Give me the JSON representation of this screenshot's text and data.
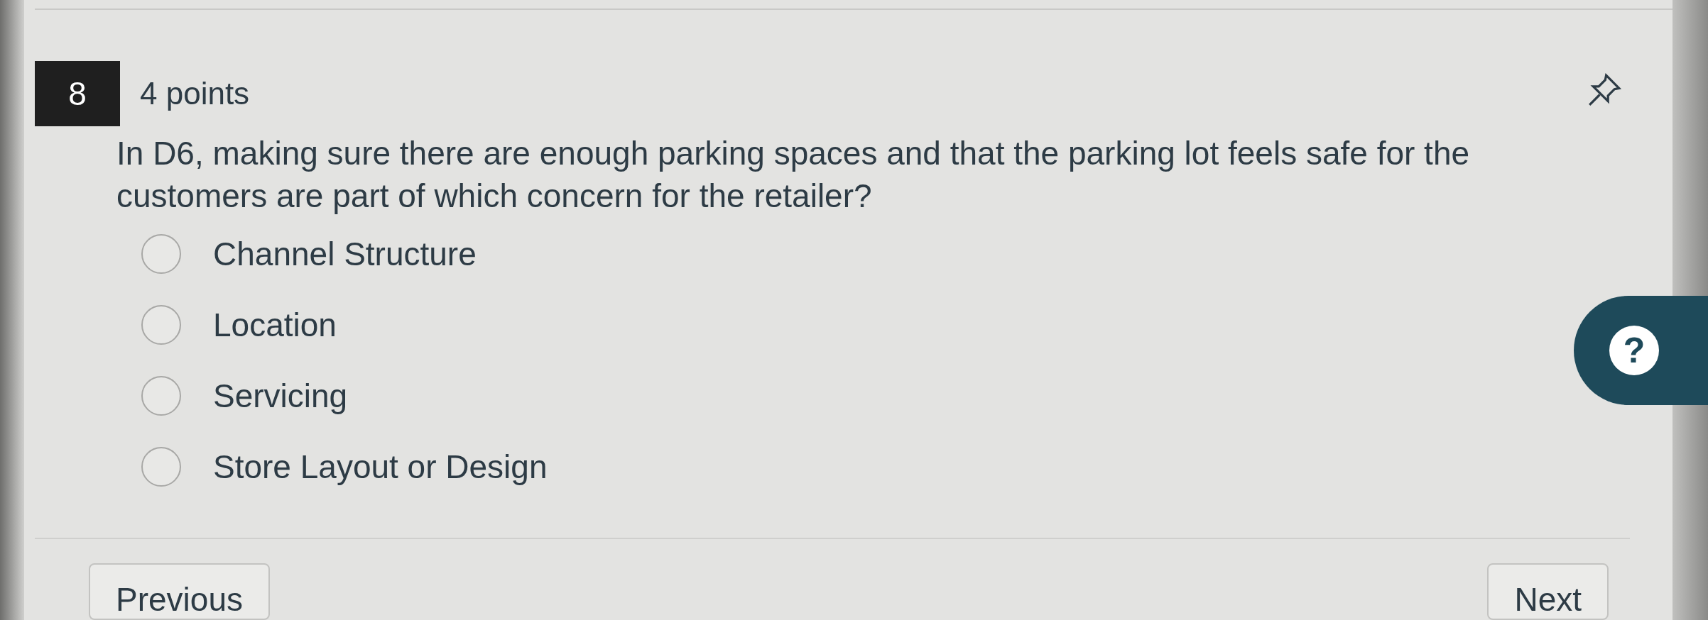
{
  "question": {
    "number": "8",
    "points": "4 points",
    "text": "In D6, making sure there are enough parking spaces and that the parking lot feels safe for the customers are part of which concern for the retailer?"
  },
  "options": [
    {
      "label": "Channel Structure",
      "selected": false
    },
    {
      "label": "Location",
      "selected": false
    },
    {
      "label": "Servicing",
      "selected": false
    },
    {
      "label": "Store Layout or Design",
      "selected": false
    }
  ],
  "help": {
    "label": "?"
  },
  "nav": {
    "previous": "Previous",
    "next": "Next"
  }
}
